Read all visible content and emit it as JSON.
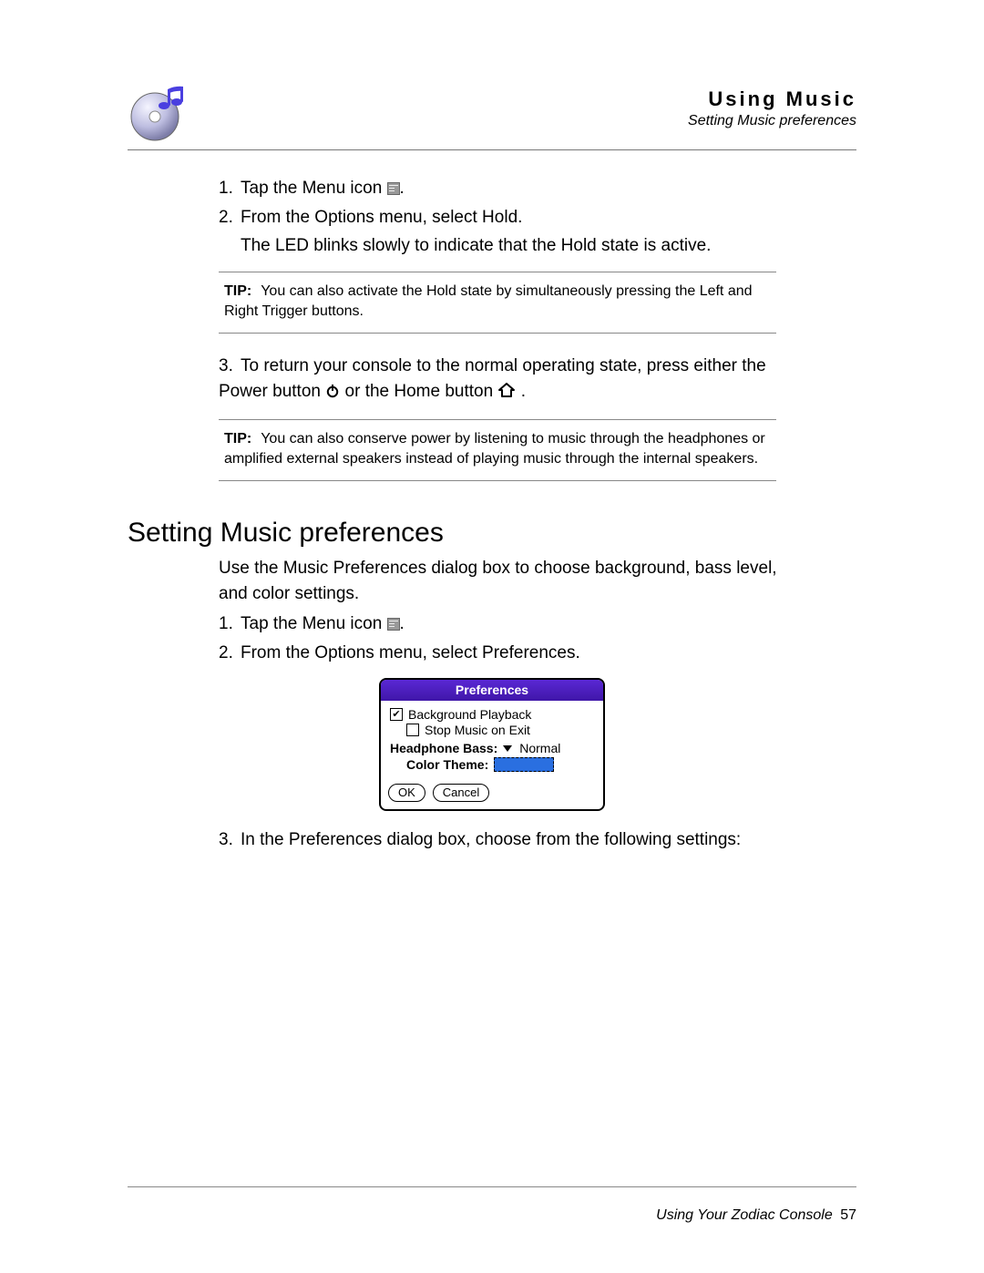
{
  "header": {
    "chapter": "Using Music",
    "breadcrumb": "Setting Music preferences"
  },
  "steps_a": {
    "s1_prefix": "Tap the Menu icon ",
    "s1_suffix": ".",
    "s2": "From the Options menu, select Hold.",
    "s2_note": "The LED blinks slowly to indicate that the Hold state is active."
  },
  "tip1": {
    "label": "TIP:",
    "text": "You can also activate the Hold state by simultaneously pressing the Left and Right Trigger buttons."
  },
  "steps_b": {
    "s3_part1": "To return your console to the normal operating state, press either the Power button ",
    "s3_part2": " or the Home button ",
    "s3_part3": "."
  },
  "tip2": {
    "label": "TIP:",
    "text": "You can also conserve power by listening to music through the headphones or amplified external speakers instead of playing music through the internal speakers."
  },
  "section2": {
    "heading": "Setting Music preferences",
    "intro": "Use the Music Preferences dialog box to choose background, bass level, and color settings.",
    "s1_prefix": "Tap the Menu icon ",
    "s1_suffix": ".",
    "s2": "From the Options menu, select Preferences.",
    "s3": "In the Preferences dialog box, choose from the following settings:"
  },
  "dialog": {
    "title": "Preferences",
    "opt_bg": "Background Playback",
    "opt_bg_checked": true,
    "opt_stop": "Stop Music on Exit",
    "opt_stop_checked": false,
    "bass_label": "Headphone Bass:",
    "bass_value": "Normal",
    "theme_label": "Color Theme:",
    "theme_swatch_color": "#2a6fe0",
    "ok": "OK",
    "cancel": "Cancel"
  },
  "footer": {
    "book": "Using Your Zodiac Console",
    "page": "57"
  }
}
